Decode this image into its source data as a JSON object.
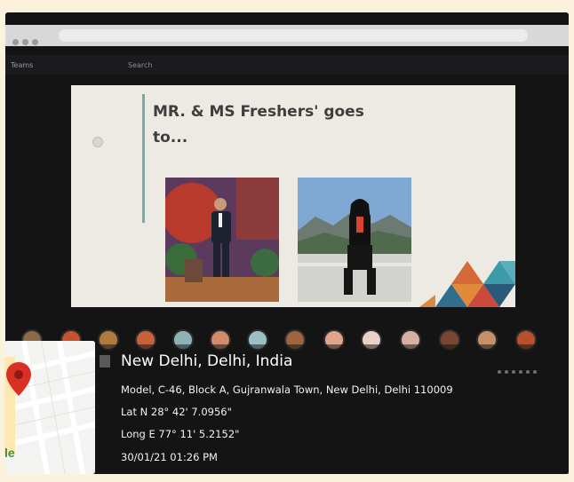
{
  "teams": {
    "app_name": "Teams",
    "search_placeholder": "Search"
  },
  "slide": {
    "title": "MR. & MS Freshers' goes to..."
  },
  "geotag": {
    "city": "New Delhi, Delhi, India",
    "address": "Model, C-46, Block A, Gujranwala Town, New Delhi, Delhi 110009",
    "latitude": "Lat N 28° 42' 7.0956\"",
    "longitude": "Long E 77° 11' 5.2152\"",
    "datetime": "30/01/21 01:26 PM",
    "map_brand_fragment": "le"
  },
  "participant_count_visible": 14,
  "colors": {
    "background": "#fbf1dc",
    "map_pin": "#d93025",
    "slide_bg": "#eceae2"
  }
}
